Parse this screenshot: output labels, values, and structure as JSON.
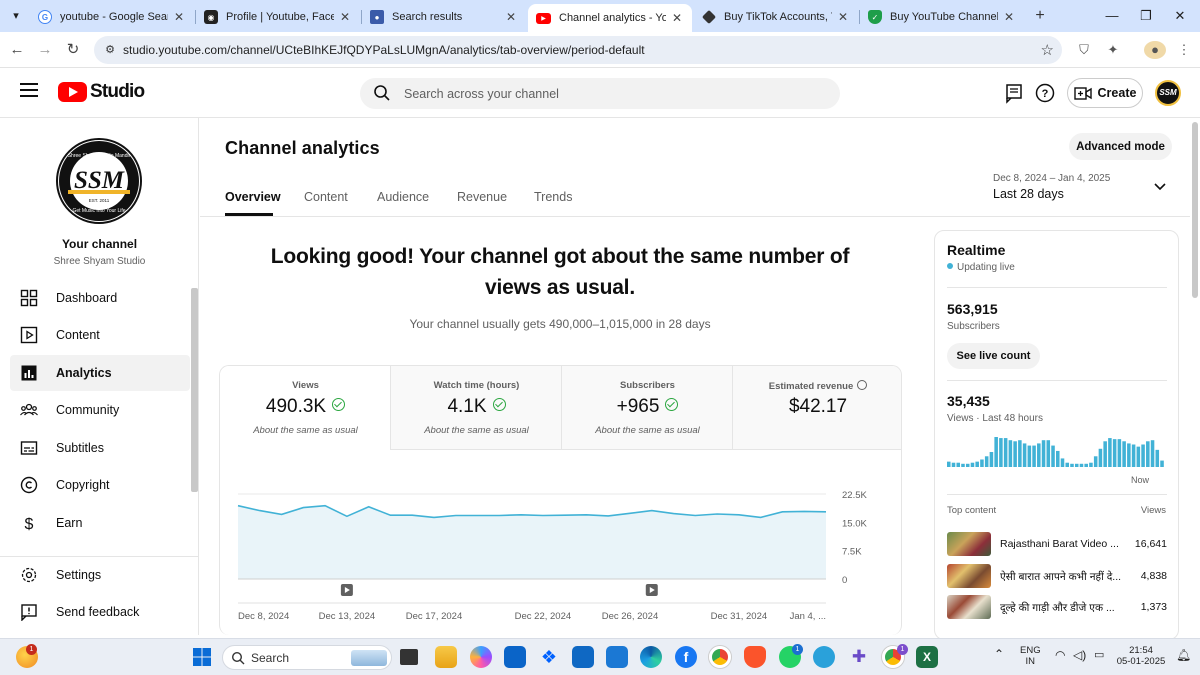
{
  "browser": {
    "tabs": [
      {
        "title": "youtube - Google Search",
        "favicon": "google-icon",
        "active": false
      },
      {
        "title": "Profile | Youtube, Facebook",
        "favicon": "profile-icon",
        "active": false
      },
      {
        "title": "Search results",
        "favicon": "person-icon",
        "active": false
      },
      {
        "title": "Channel analytics - YouTube",
        "favicon": "youtube-icon",
        "active": true
      },
      {
        "title": "Buy TikTok Accounts, Yout",
        "favicon": "diamond-icon",
        "active": false
      },
      {
        "title": "Buy YouTube Channel | Tru",
        "favicon": "shield-icon",
        "active": false
      }
    ],
    "url": "studio.youtube.com/channel/UCteBIhKEJfQDYPaLsLUMgnA/analytics/tab-overview/period-default"
  },
  "header": {
    "logo_text": "Studio",
    "search_placeholder": "Search across your channel",
    "create_label": "Create",
    "avatar_text": "SSM"
  },
  "sidebar": {
    "channel_logo_text": "SSM",
    "channel_logo_top": "Shree Shyam Studio Mandir",
    "channel_logo_bottom": "Get Music Into Your Life",
    "channel_logo_est": "EST. 2011",
    "channel_title": "Your channel",
    "channel_name": "Shree Shyam Studio",
    "items": [
      {
        "label": "Dashboard",
        "icon": "dashboard-icon"
      },
      {
        "label": "Content",
        "icon": "content-icon"
      },
      {
        "label": "Analytics",
        "icon": "analytics-icon",
        "active": true
      },
      {
        "label": "Community",
        "icon": "community-icon"
      },
      {
        "label": "Subtitles",
        "icon": "subtitles-icon"
      },
      {
        "label": "Copyright",
        "icon": "copyright-icon"
      },
      {
        "label": "Earn",
        "icon": "earn-icon"
      }
    ],
    "bottom_items": [
      {
        "label": "Settings",
        "icon": "settings-icon"
      },
      {
        "label": "Send feedback",
        "icon": "feedback-icon"
      }
    ]
  },
  "main": {
    "title": "Channel analytics",
    "advanced_mode": "Advanced mode",
    "tabs": [
      "Overview",
      "Content",
      "Audience",
      "Revenue",
      "Trends"
    ],
    "date_range": "Dec 8, 2024 – Jan 4, 2025",
    "date_label": "Last 28 days",
    "headline": "Looking good! Your channel got about the same number of views as usual.",
    "subline": "Your channel usually gets 490,000–1,015,000 in 28 days",
    "metrics": [
      {
        "label": "Views",
        "value": "490.3K",
        "note": "About the same as usual",
        "check": true
      },
      {
        "label": "Watch time (hours)",
        "value": "4.1K",
        "note": "About the same as usual",
        "check": true
      },
      {
        "label": "Subscribers",
        "value": "+965",
        "note": "About the same as usual",
        "check": true
      },
      {
        "label": "Estimated revenue",
        "value": "$42.17",
        "note": "",
        "check": false
      }
    ]
  },
  "chart_data": {
    "type": "area",
    "ylim": [
      0,
      22500
    ],
    "y_ticks": [
      "22.5K",
      "15.0K",
      "7.5K",
      "0"
    ],
    "x_labels": [
      "Dec 8, 2024",
      "Dec 13, 2024",
      "Dec 17, 2024",
      "Dec 22, 2024",
      "Dec 26, 2024",
      "Dec 31, 2024",
      "Jan 4, ..."
    ],
    "series": [
      {
        "values": [
          19400,
          18100,
          17100,
          18900,
          19400,
          16600,
          19100,
          16900,
          16900,
          16300,
          16800,
          16800,
          16800,
          17000,
          16800,
          16900,
          17000,
          16700,
          17400,
          18100,
          17300,
          16800,
          17200,
          17000,
          16300,
          17800,
          17900,
          17800
        ],
        "color": "#41b2d6"
      }
    ],
    "grid": true
  },
  "realtime": {
    "title": "Realtime",
    "status": "Updating live",
    "subscribers_value": "563,915",
    "subscribers_label": "Subscribers",
    "live_button": "See live count",
    "views_value": "35,435",
    "views_label": "Views · Last 48 hours",
    "now_label": "Now",
    "bar_values": [
      5,
      4,
      4,
      3,
      3,
      4,
      5,
      7,
      10,
      14,
      28,
      27,
      27,
      25,
      24,
      25,
      22,
      20,
      20,
      22,
      25,
      25,
      20,
      15,
      8,
      4,
      3,
      3,
      3,
      3,
      4,
      10,
      17,
      24,
      27,
      26,
      26,
      24,
      22,
      21,
      19,
      21,
      24,
      25,
      16,
      6
    ],
    "top_content_label": "Top content",
    "views_col_label": "Views",
    "top_content": [
      {
        "title": "Rajasthani Barat Video ...",
        "views": "16,641"
      },
      {
        "title": "ऐसी बारात आपने कभी नहीं दे...",
        "views": "4,838"
      },
      {
        "title": "दूल्हे की गाड़ी और डीजे एक ...",
        "views": "1,373"
      }
    ]
  },
  "taskbar": {
    "search_label": "Search",
    "lang_top": "ENG",
    "lang_bottom": "IN",
    "time": "21:54",
    "date": "05-01-2025",
    "apps": [
      "weather-icon",
      "start-icon",
      "search-box",
      "widgets-icon",
      "task-view-icon",
      "file-explorer-icon",
      "copilot-icon",
      "outlook-icon",
      "dropbox-icon",
      "store-icon",
      "snip-icon",
      "edge-icon",
      "facebook-icon",
      "chrome-icon",
      "brave-icon",
      "whatsapp-icon",
      "telegram-icon",
      "puzzle-icon",
      "chrome-profile-icon",
      "excel-icon"
    ]
  }
}
